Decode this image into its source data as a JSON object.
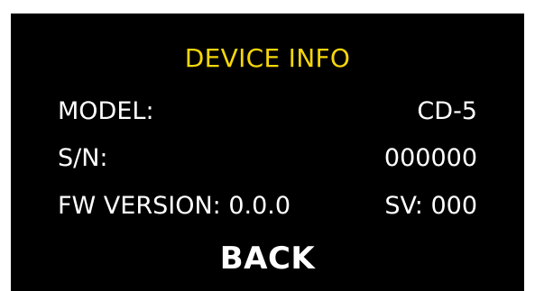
{
  "screen": {
    "title": "DEVICE INFO",
    "colors": {
      "background": "#000000",
      "title": "#f5d60b",
      "text": "#ffffff"
    },
    "rows": [
      {
        "label": "MODEL:",
        "value": "CD-5"
      },
      {
        "label": "S/N:",
        "value": "000000"
      },
      {
        "label": "FW VERSION: 0.0.0",
        "value": "SV: 000"
      }
    ],
    "back_label": "BACK"
  }
}
